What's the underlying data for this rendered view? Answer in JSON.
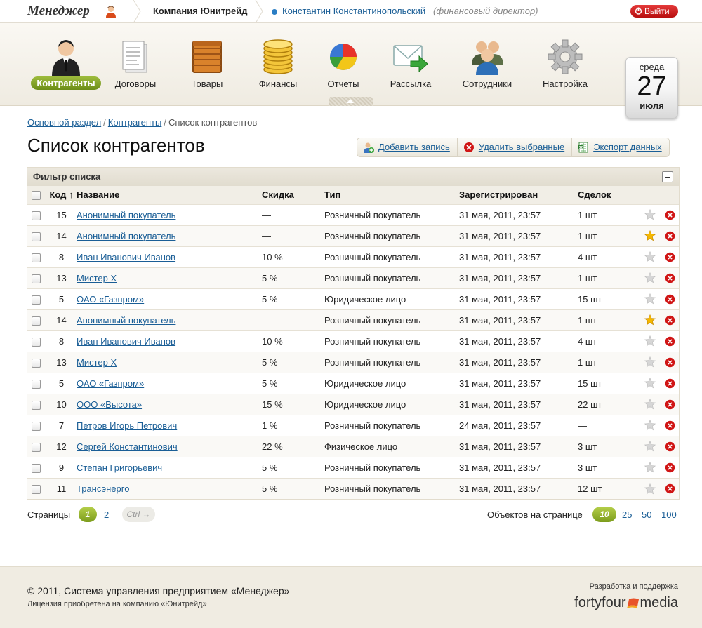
{
  "header": {
    "logo": "Менеджер",
    "company": "Компания Юнитрейд",
    "user_name": "Константин Константинопольский",
    "user_role": "(финансовый директор)",
    "logout": "Выйти"
  },
  "nav": {
    "items": [
      {
        "label": "Контрагенты",
        "icon": "user-icon",
        "active": true
      },
      {
        "label": "Договоры",
        "icon": "document-icon"
      },
      {
        "label": "Товары",
        "icon": "crate-icon"
      },
      {
        "label": "Финансы",
        "icon": "coins-icon"
      },
      {
        "label": "Отчеты",
        "icon": "pie-chart-icon"
      },
      {
        "label": "Рассылка",
        "icon": "mail-send-icon"
      },
      {
        "label": "Сотрудники",
        "icon": "team-icon"
      },
      {
        "label": "Настройка",
        "icon": "gear-icon"
      }
    ]
  },
  "calendar": {
    "weekday": "среда",
    "day": "27",
    "month": "июля"
  },
  "breadcrumb": {
    "home": "Основной раздел",
    "section": "Контрагенты",
    "current": "Список контрагентов"
  },
  "page": {
    "title": "Список контрагентов"
  },
  "actions": {
    "add": "Добавить запись",
    "delete": "Удалить выбранные",
    "export": "Экспорт данных"
  },
  "filter": {
    "title": "Фильтр списка"
  },
  "table": {
    "columns": {
      "code": "Код",
      "sort_arrow": "↑",
      "name": "Название",
      "discount": "Скидка",
      "type": "Тип",
      "registered": "Зарегистрирован",
      "deals": "Сделок"
    },
    "rows": [
      {
        "code": "15",
        "name": "Анонимный покупатель",
        "discount": "—",
        "type": "Розничный покупатель",
        "registered": "31 мая, 2011, 23:57",
        "deals": "1 шт",
        "starred": false
      },
      {
        "code": "14",
        "name": "Анонимный покупатель",
        "discount": "—",
        "type": "Розничный покупатель",
        "registered": "31 мая, 2011, 23:57",
        "deals": "1 шт",
        "starred": true
      },
      {
        "code": "8",
        "name": "Иван Иванович Иванов",
        "discount": "10 %",
        "type": "Розничный покупатель",
        "registered": "31 мая, 2011, 23:57",
        "deals": "4 шт",
        "starred": false
      },
      {
        "code": "13",
        "name": "Мистер Х",
        "discount": "5 %",
        "type": "Розничный покупатель",
        "registered": "31 мая, 2011, 23:57",
        "deals": "1 шт",
        "starred": false
      },
      {
        "code": "5",
        "name": "ОАО «Газпром»",
        "discount": "5 %",
        "type": "Юридическое лицо",
        "registered": "31 мая, 2011, 23:57",
        "deals": "15 шт",
        "starred": false
      },
      {
        "code": "14",
        "name": "Анонимный покупатель",
        "discount": "—",
        "type": "Розничный покупатель",
        "registered": "31 мая, 2011, 23:57",
        "deals": "1 шт",
        "starred": true
      },
      {
        "code": "8",
        "name": "Иван Иванович Иванов",
        "discount": "10 %",
        "type": "Розничный покупатель",
        "registered": "31 мая, 2011, 23:57",
        "deals": "4 шт",
        "starred": false
      },
      {
        "code": "13",
        "name": "Мистер Х",
        "discount": "5 %",
        "type": "Розничный покупатель",
        "registered": "31 мая, 2011, 23:57",
        "deals": "1 шт",
        "starred": false
      },
      {
        "code": "5",
        "name": "ОАО «Газпром»",
        "discount": "5 %",
        "type": "Юридическое лицо",
        "registered": "31 мая, 2011, 23:57",
        "deals": "15 шт",
        "starred": false
      },
      {
        "code": "10",
        "name": "ООО «Высота»",
        "discount": "15 %",
        "type": "Юридическое лицо",
        "registered": "31 мая, 2011, 23:57",
        "deals": "22 шт",
        "starred": false
      },
      {
        "code": "7",
        "name": "Петров Игорь Петрович",
        "discount": "1 %",
        "type": "Розничный покупатель",
        "registered": "24 мая, 2011, 23:57",
        "deals": "—",
        "starred": false
      },
      {
        "code": "12",
        "name": "Сергей Константинович",
        "discount": "22 %",
        "type": "Физическое лицо",
        "registered": "31 мая, 2011, 23:57",
        "deals": "3 шт",
        "starred": false
      },
      {
        "code": "9",
        "name": "Степан Григорьевич",
        "discount": "5 %",
        "type": "Розничный покупатель",
        "registered": "31 мая, 2011, 23:57",
        "deals": "3 шт",
        "starred": false
      },
      {
        "code": "11",
        "name": "Трансэнерго",
        "discount": "5 %",
        "type": "Розничный покупатель",
        "registered": "31 мая, 2011, 23:57",
        "deals": "12 шт",
        "starred": false
      }
    ]
  },
  "pagination": {
    "label": "Страницы",
    "current": "1",
    "pages": [
      "2"
    ],
    "next": "Ctrl →",
    "per_page_label": "Объектов на странице",
    "per_page_current": "10",
    "per_page_options": [
      "25",
      "50",
      "100"
    ]
  },
  "footer": {
    "copyright": "© 2011, Система управления предприятием «Менеджер»",
    "license": "Лицензия приобретена на компанию «Юнитрейд»",
    "dev_label": "Разработка и поддержка",
    "brand_left": "fortyfour",
    "brand_right": "media"
  },
  "colors": {
    "accent_green": "#7c9c1c",
    "link": "#1a5e96",
    "danger": "#d01515",
    "star": "#f5b800"
  }
}
